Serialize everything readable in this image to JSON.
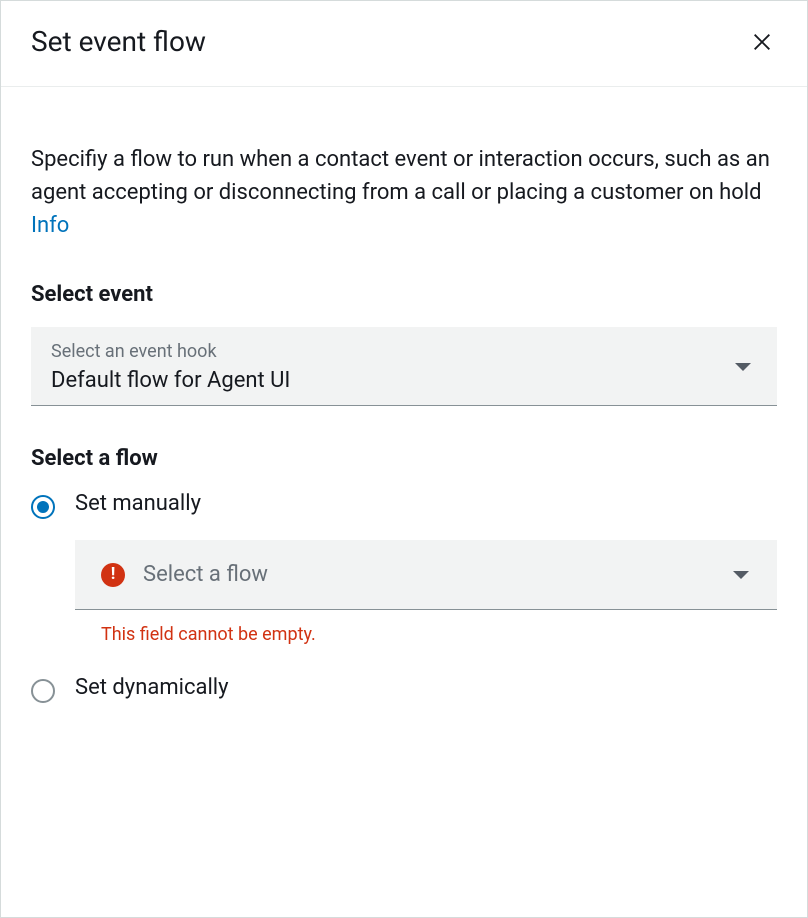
{
  "header": {
    "title": "Set event flow"
  },
  "description": {
    "text": "Specifiy a flow to run when a contact event or interaction occurs, such as an agent accepting or disconnecting from a call or placing a customer on hold ",
    "info_link": "Info"
  },
  "event_section": {
    "label": "Select event",
    "field_label": "Select an event hook",
    "value": "Default flow for Agent UI"
  },
  "flow_section": {
    "label": "Select a flow",
    "options": {
      "manual": {
        "label": "Set manually",
        "nested_placeholder": "Select a flow",
        "error": "This field cannot be empty."
      },
      "dynamic": {
        "label": "Set dynamically"
      }
    }
  }
}
